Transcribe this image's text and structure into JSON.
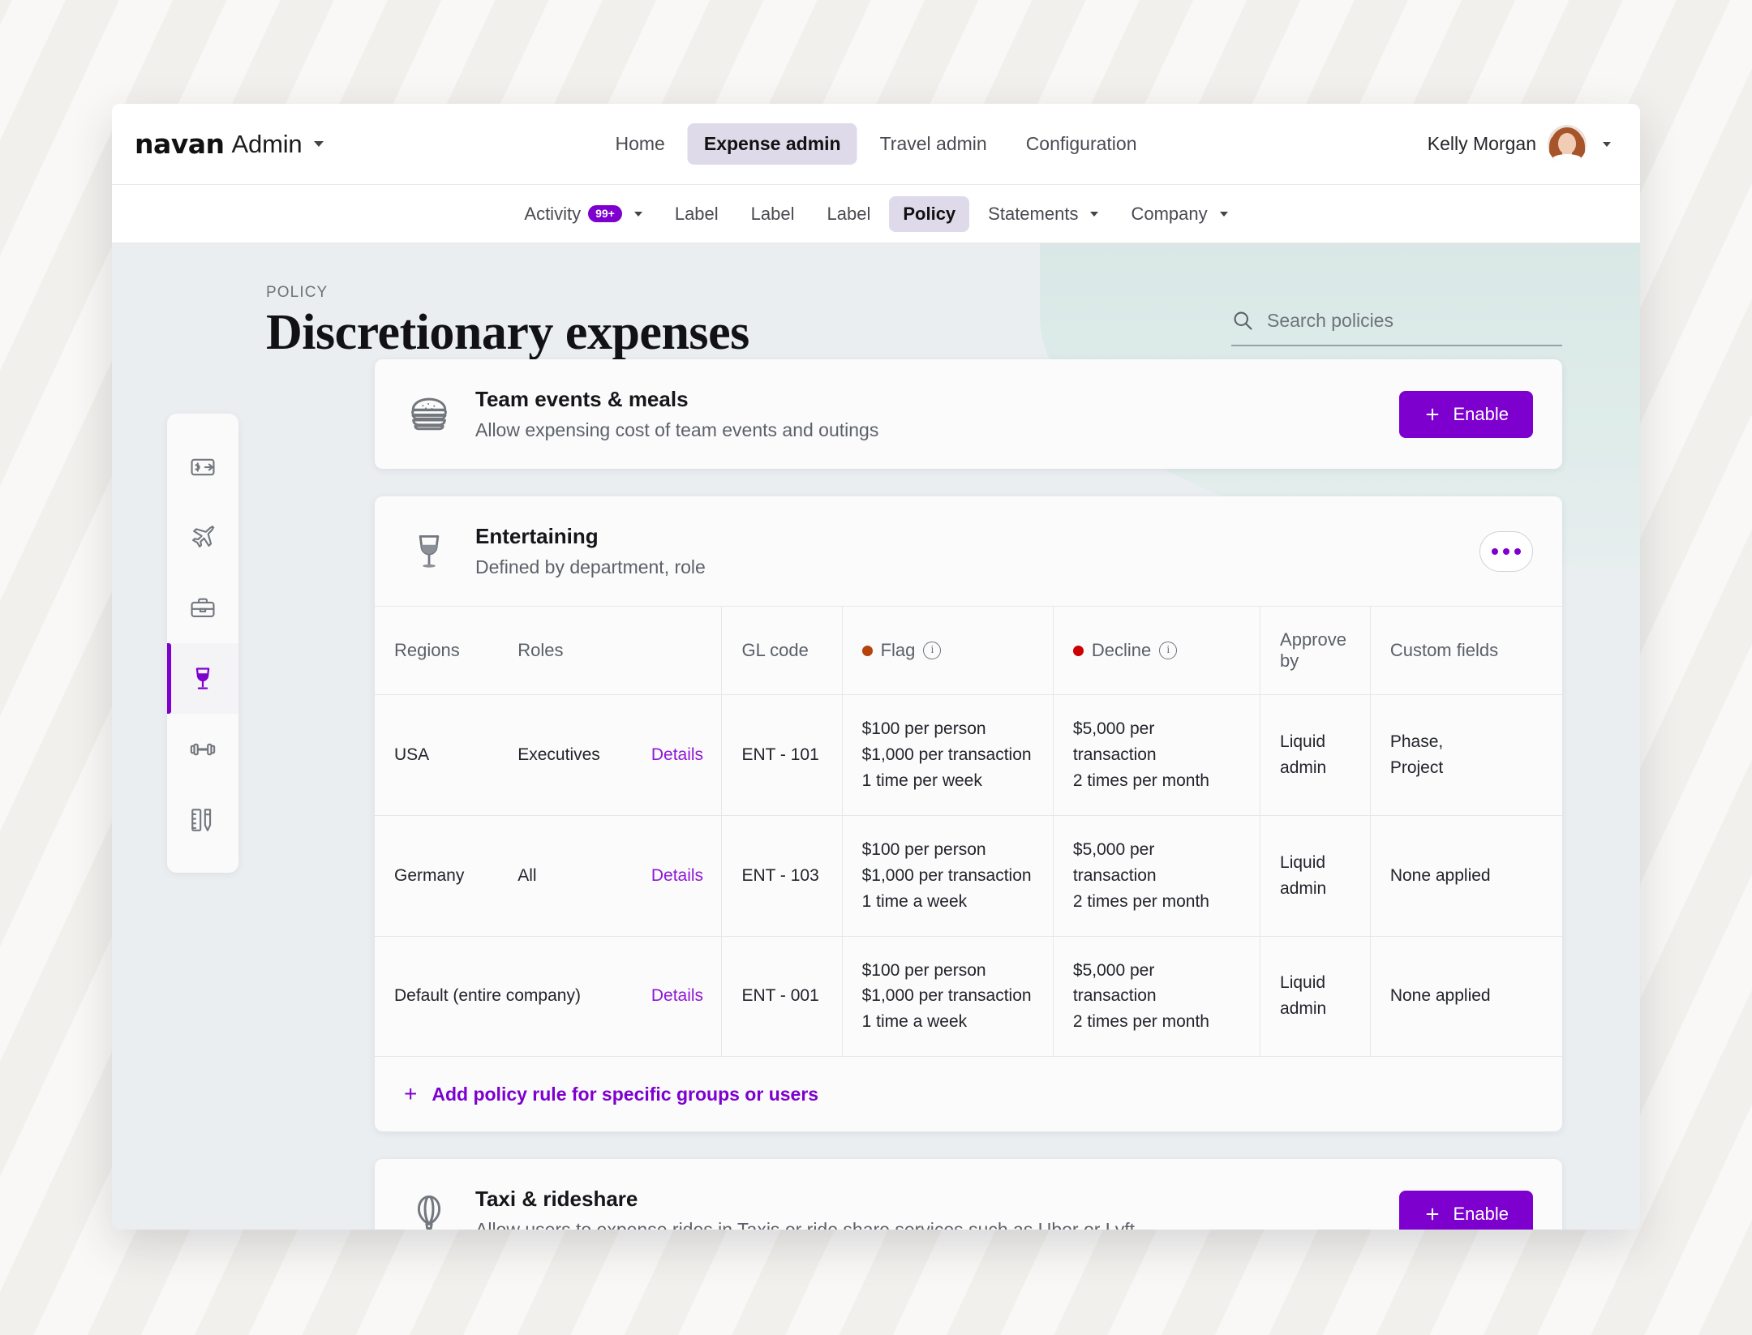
{
  "brand": {
    "logo": "navan",
    "suffix": "Admin"
  },
  "topnav": {
    "items": [
      {
        "label": "Home",
        "active": false
      },
      {
        "label": "Expense admin",
        "active": true
      },
      {
        "label": "Travel admin",
        "active": false
      },
      {
        "label": "Configuration",
        "active": false
      }
    ]
  },
  "user": {
    "name": "Kelly Morgan"
  },
  "subnav": {
    "activity": {
      "label": "Activity",
      "badge": "99+"
    },
    "label1": "Label",
    "label2": "Label",
    "label3": "Label",
    "policy": "Policy",
    "statements": "Statements",
    "company": "Company"
  },
  "hero": {
    "eyebrow": "POLICY",
    "title": "Discretionary expenses"
  },
  "search": {
    "placeholder": "Search policies",
    "value": ""
  },
  "rail": {
    "items": [
      {
        "icon": "money-transfer-icon",
        "active": false
      },
      {
        "icon": "airplane-icon",
        "active": false
      },
      {
        "icon": "briefcase-icon",
        "active": false
      },
      {
        "icon": "wine-glass-icon",
        "active": true
      },
      {
        "icon": "dumbbell-icon",
        "active": false
      },
      {
        "icon": "ruler-pen-icon",
        "active": false
      }
    ]
  },
  "cards": {
    "team_events": {
      "icon": "burger-icon",
      "title": "Team events & meals",
      "subtitle": "Allow expensing cost of team events and outings",
      "enable_label": "Enable"
    },
    "entertaining": {
      "icon": "wine-glass-icon",
      "title": "Entertaining",
      "subtitle": "Defined by department, role",
      "add_rule_label": "Add policy rule for specific groups or users",
      "table": {
        "columns": [
          "Regions",
          "Roles",
          "GL code",
          "Flag",
          "Decline",
          "Approve by",
          "Custom fields"
        ],
        "rows": [
          {
            "region": "USA",
            "role": "Executives",
            "details": "Details",
            "gl_code": "ENT - 101",
            "flag": [
              "$100 per person",
              "$1,000 per transaction",
              "1 time per week"
            ],
            "decline": [
              "$5,000 per transaction",
              "2 times per month"
            ],
            "approve_by": "Liquid admin",
            "custom_fields": [
              "Phase,",
              "Project"
            ],
            "custom_fields_muted": false,
            "region_muted": false
          },
          {
            "region": "Germany",
            "role": "All",
            "details": "Details",
            "gl_code": "ENT - 103",
            "flag": [
              "$100 per person",
              "$1,000 per transaction",
              "1 time a week"
            ],
            "decline": [
              "$5,000 per transaction",
              "2 times per month"
            ],
            "approve_by": "Liquid admin",
            "custom_fields": [
              "None applied"
            ],
            "custom_fields_muted": true,
            "region_muted": false
          },
          {
            "region": "Default (entire company)",
            "role": "",
            "details": "Details",
            "gl_code": "ENT - 001",
            "flag": [
              "$100 per person",
              "$1,000 per transaction",
              "1 time a week"
            ],
            "decline": [
              "$5,000 per transaction",
              "2 times per month"
            ],
            "approve_by": "Liquid admin",
            "custom_fields": [
              "None applied"
            ],
            "custom_fields_muted": true,
            "region_muted": true
          }
        ]
      }
    },
    "taxi": {
      "icon": "hot-air-balloon-icon",
      "title": "Taxi & rideshare",
      "subtitle": "Allow users to expense rides in Taxis or ride share services such as Uber or Lyft",
      "enable_label": "Enable"
    }
  },
  "colors": {
    "accent_purple": "#7d00cf",
    "link_purple": "#9016d6",
    "flag_dot": "#b5430a",
    "decline_dot": "#cc0000",
    "hero_teal": "#d9e8e6"
  }
}
